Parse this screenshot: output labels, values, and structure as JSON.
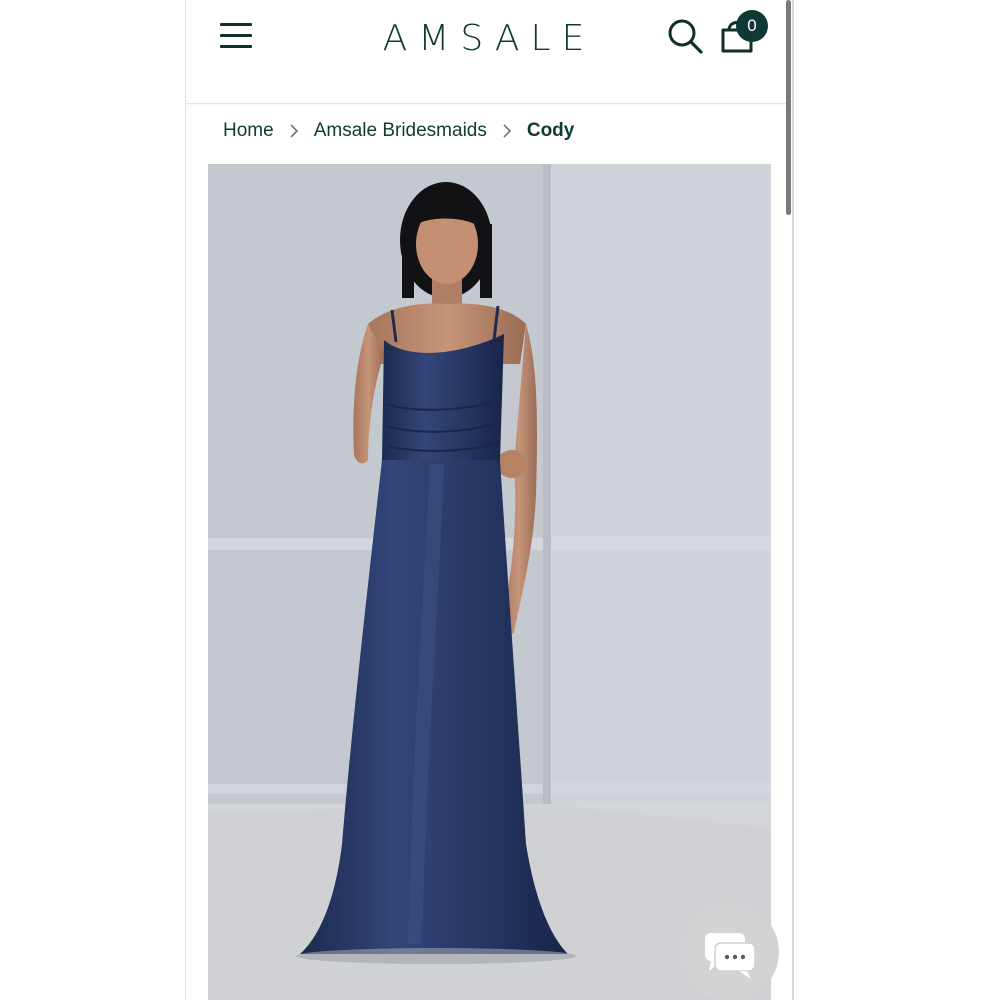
{
  "header": {
    "brand": "AMSALE",
    "cart_count": "0",
    "icons": {
      "menu": "hamburger-menu-icon",
      "search": "search-icon",
      "cart": "shopping-bag-icon"
    },
    "brand_color": "#0f3a33"
  },
  "breadcrumb": {
    "items": [
      {
        "label": "Home"
      },
      {
        "label": "Amsale Bridesmaids"
      },
      {
        "label": "Cody"
      }
    ],
    "separator_icon": "chevron-right-icon"
  },
  "product": {
    "image_alt_icon": "product-photo",
    "dress_color": "#26355f"
  },
  "chat": {
    "icon": "chat-bubbles-icon"
  }
}
